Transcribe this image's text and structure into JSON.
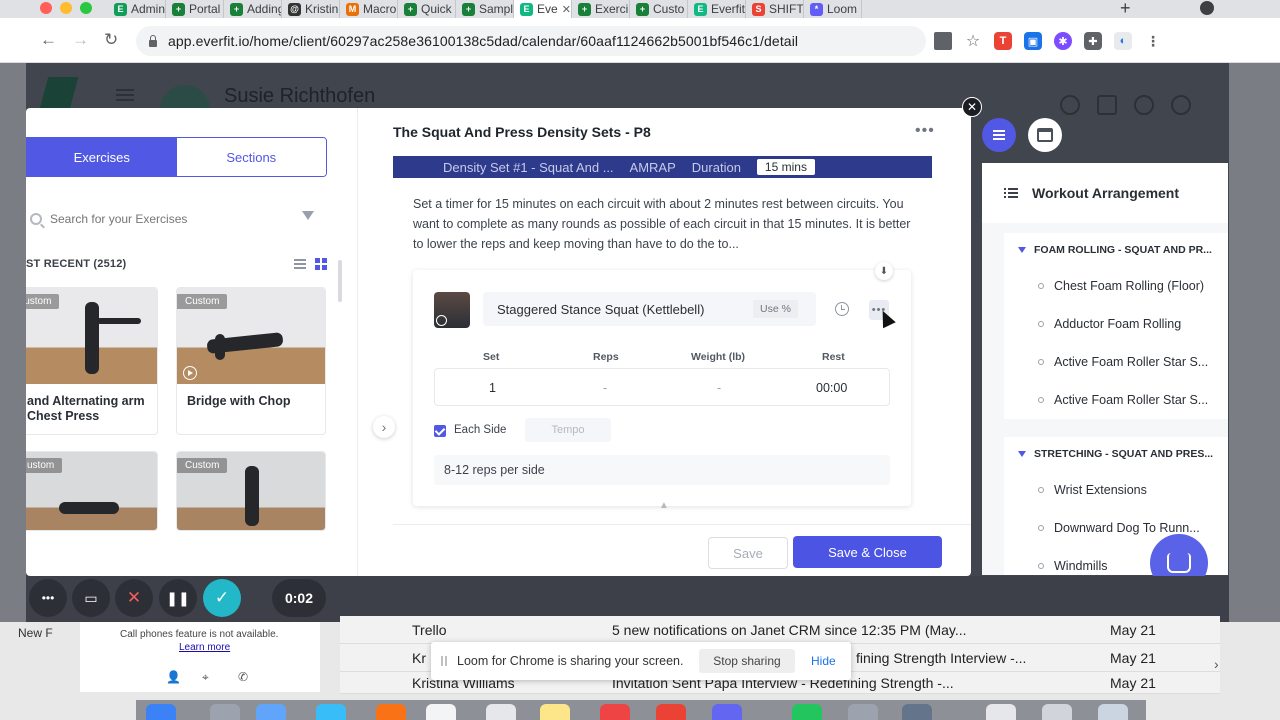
{
  "browser": {
    "tabs": [
      {
        "label": "Admin",
        "color": "#0f9d58",
        "glyph": "E"
      },
      {
        "label": "Portal",
        "color": "#188038",
        "glyph": "+"
      },
      {
        "label": "Adding",
        "color": "#188038",
        "glyph": "+"
      },
      {
        "label": "Kristin",
        "color": "#333333",
        "glyph": "@"
      },
      {
        "label": "Macro",
        "color": "#e8710a",
        "glyph": "M"
      },
      {
        "label": "Quick",
        "color": "#188038",
        "glyph": "+"
      },
      {
        "label": "Sampl",
        "color": "#188038",
        "glyph": "+"
      },
      {
        "label": "Eve",
        "color": "#10b981",
        "glyph": "E",
        "active": true
      },
      {
        "label": "Exerci",
        "color": "#188038",
        "glyph": "+"
      },
      {
        "label": "Custo",
        "color": "#188038",
        "glyph": "+"
      },
      {
        "label": "Everfit",
        "color": "#10b981",
        "glyph": "E"
      },
      {
        "label": "SHIFT",
        "color": "#ea4335",
        "glyph": "S"
      },
      {
        "label": "Loom",
        "color": "#625df5",
        "glyph": "*"
      }
    ],
    "url": "app.everfit.io/home/client/60297ac258e36100138c5dad/calendar/60aaf1124662b5001bf546c1/detail"
  },
  "page": {
    "client_name": "Susie Richthofen"
  },
  "library": {
    "tab_exercises": "Exercises",
    "tab_sections": "Sections",
    "search_placeholder": "Search for your Exercises",
    "recent_label": "ST RECENT (2512)",
    "cards": [
      {
        "tag": "Custom",
        "name": "and Alternating arm Chest Press",
        "video": false
      },
      {
        "tag": "Custom",
        "name": "Bridge with Chop",
        "video": true
      },
      {
        "tag": "ustom",
        "name": "",
        "video": false
      },
      {
        "tag": "Custom",
        "name": "",
        "video": false
      }
    ]
  },
  "workout": {
    "title": "The Squat And Press Density Sets - P8",
    "section_bar": {
      "name": "Density Set #1 - Squat And ...",
      "type": "AMRAP",
      "duration_label": "Duration",
      "duration_value": "15 mins"
    },
    "description": "Set a timer for 15 minutes on each circuit with about 2 minutes rest between circuits. You want to complete as many rounds as possible of each circuit in that 15 minutes. It is better to lower the reps and keep moving than have to do the to...",
    "exercise": {
      "name": "Staggered Stance Squat (Kettlebell)",
      "use_percent": "Use %",
      "columns": [
        "Set",
        "Reps",
        "Weight (lb)",
        "Rest"
      ],
      "row": [
        "1",
        "-",
        "-",
        "00:00"
      ],
      "each_side_label": "Each Side",
      "tempo_placeholder": "Tempo",
      "note": "8-12 reps per side"
    },
    "save_label": "Save",
    "save_close_label": "Save & Close"
  },
  "arrangement": {
    "title": "Workout Arrangement",
    "sections": [
      {
        "title": "FOAM ROLLING - SQUAT AND PR...",
        "items": [
          "Chest Foam Rolling (Floor)",
          "Adductor Foam Rolling",
          "Active Foam Roller Star S...",
          "Active Foam Roller Star S..."
        ]
      },
      {
        "title": "STRETCHING - SQUAT AND PRES...",
        "items": [
          "Wrist Extensions",
          "Downward Dog To Runn...",
          "Windmills"
        ]
      }
    ]
  },
  "recorder": {
    "timer": "0:02"
  },
  "background": {
    "call_text": "Call phones feature is not available.",
    "learn_more": "Learn more",
    "new_folder": "New F",
    "mail_rows": [
      {
        "sender": "Trello",
        "subject": "5 new notifications on Janet CRM since 12:35 PM (May...",
        "date": "May 21"
      },
      {
        "sender": "Kr",
        "subject": "fining Strength Interview -...",
        "date": "May 21"
      },
      {
        "sender": "Kristina Williams",
        "subject": "Invitation Sent Papa Interview - Redefining Strength -...",
        "date": "May 21"
      }
    ]
  },
  "loom_banner": {
    "message": "Loom for Chrome is sharing your screen.",
    "stop_label": "Stop sharing",
    "hide_label": "Hide"
  },
  "colors": {
    "accent": "#5158e4",
    "section_bar": "#2e3a8c",
    "recorder_green": "#22b8c8",
    "recorder_red": "#f25f5c"
  }
}
